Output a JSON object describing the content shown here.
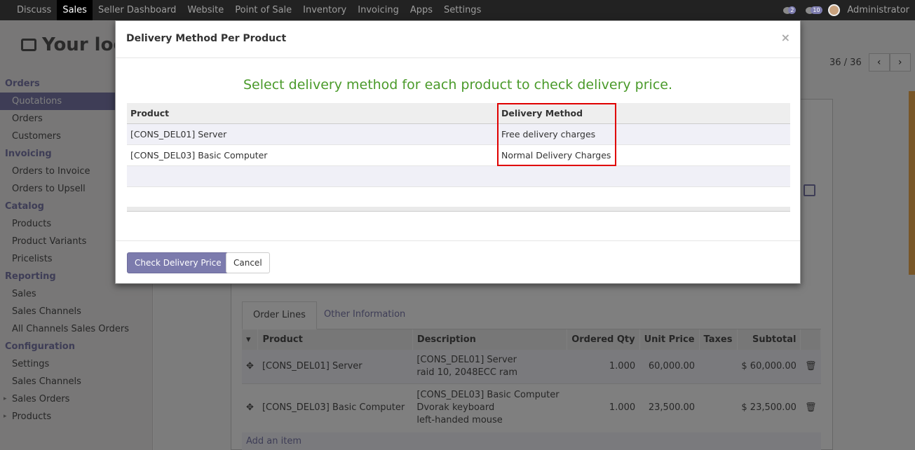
{
  "topbar": {
    "menu": [
      "Discuss",
      "Sales",
      "Seller Dashboard",
      "Website",
      "Point of Sale",
      "Inventory",
      "Invoicing",
      "Apps",
      "Settings"
    ],
    "active_menu": "Sales",
    "chat_count": "2",
    "activity_count": "10",
    "user": "Administrator"
  },
  "logo": {
    "text": "Your log"
  },
  "sidebar": {
    "orders_section": "Orders",
    "quotations": "Quotations",
    "orders": "Orders",
    "customers": "Customers",
    "invoicing_section": "Invoicing",
    "orders_to_invoice": "Orders to Invoice",
    "orders_to_upsell": "Orders to Upsell",
    "catalog_section": "Catalog",
    "products": "Products",
    "product_variants": "Product Variants",
    "pricelists": "Pricelists",
    "reporting_section": "Reporting",
    "sales": "Sales",
    "sales_channels": "Sales Channels",
    "all_channels": "All Channels Sales Orders",
    "configuration_section": "Configuration",
    "settings": "Settings",
    "config_sales_channels": "Sales Channels",
    "sales_orders": "Sales Orders",
    "config_products": "Products"
  },
  "pager": {
    "value": "36 / 36",
    "prev": "‹",
    "next": "›"
  },
  "order": {
    "tabs": [
      "Order Lines",
      "Other Information"
    ],
    "headers": [
      "Product",
      "Description",
      "Ordered Qty",
      "Unit Price",
      "Taxes",
      "Subtotal"
    ],
    "lines": [
      {
        "product": "[CONS_DEL01] Server",
        "description": [
          "[CONS_DEL01] Server",
          "raid 10, 2048ECC ram"
        ],
        "qty": "1.000",
        "unit_price": "60,000.00",
        "taxes": "",
        "subtotal": "$ 60,000.00"
      },
      {
        "product": "[CONS_DEL03] Basic Computer",
        "description": [
          "[CONS_DEL03] Basic Computer",
          "Dvorak keyboard",
          "left-handed mouse"
        ],
        "qty": "1.000",
        "unit_price": "23,500.00",
        "taxes": "",
        "subtotal": "$ 23,500.00"
      }
    ],
    "add_item": "Add an item"
  },
  "modal": {
    "title": "Delivery Method Per Product",
    "close": "×",
    "lead": "Select delivery method for each product to check delivery price.",
    "headers": [
      "Product",
      "Delivery Method"
    ],
    "rows": [
      {
        "product": "[CONS_DEL01] Server",
        "method": "Free delivery charges"
      },
      {
        "product": "[CONS_DEL03] Basic Computer",
        "method": "Normal Delivery Charges"
      }
    ],
    "check_button": "Check Delivery Price",
    "cancel_button": "Cancel"
  },
  "colors": {
    "accent": "#7c7bad",
    "lead_green": "#4a9a2a",
    "highlight_red": "#e00000",
    "topbar": "#222222"
  }
}
